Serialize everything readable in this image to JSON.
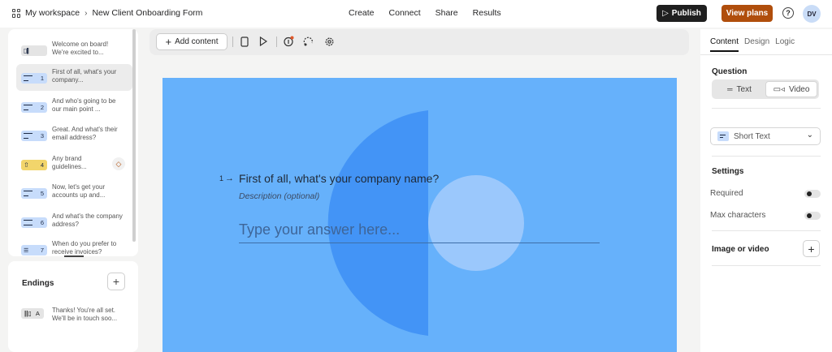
{
  "breadcrumb": {
    "workspace": "My workspace",
    "form": "New Client Onboarding Form"
  },
  "nav": [
    "Create",
    "Connect",
    "Share",
    "Results"
  ],
  "header": {
    "publish": "Publish",
    "view_plans": "View plans",
    "help": "?",
    "avatar": "DV"
  },
  "questions": [
    {
      "num": "",
      "text": "Welcome on board! We're excited to...",
      "color": "gray",
      "icon": "welcome-icon"
    },
    {
      "num": "1",
      "text": "First of all, what's your company...",
      "color": "blue",
      "icon": "short-text-icon",
      "active": true
    },
    {
      "num": "2",
      "text": "And who's going to be our main point ...",
      "color": "blue",
      "icon": "short-text-icon"
    },
    {
      "num": "3",
      "text": "Great. And what's their email address?",
      "color": "blue",
      "icon": "short-text-icon"
    },
    {
      "num": "4",
      "text": "Any brand guidelines...",
      "color": "yellow",
      "icon": "file-upload-icon"
    },
    {
      "num": "5",
      "text": "Now, let's get your accounts up and...",
      "color": "blue",
      "icon": "short-text-icon"
    },
    {
      "num": "6",
      "text": "And what's the company address?",
      "color": "blue",
      "icon": "address-icon"
    },
    {
      "num": "7",
      "text": "When do you prefer to receive invoices?",
      "color": "blue",
      "icon": "multiple-choice-icon"
    }
  ],
  "endings": {
    "title": "Endings",
    "item": {
      "letter": "A",
      "text": "Thanks! You're all set. We'll be in touch soo..."
    }
  },
  "toolbar": {
    "add_content": "Add content"
  },
  "canvas": {
    "question_num": "1",
    "question": "First of all, what's your company name?",
    "description": "Description (optional)",
    "answer_placeholder": "Type your answer here...",
    "bg_color": "#66b1fb"
  },
  "right": {
    "tabs": [
      "Content",
      "Design",
      "Logic"
    ],
    "question_label": "Question",
    "text_option": "Text",
    "video_option": "Video",
    "type": "Short Text",
    "settings_label": "Settings",
    "required_label": "Required",
    "maxchars_label": "Max characters",
    "image_label": "Image or video"
  }
}
